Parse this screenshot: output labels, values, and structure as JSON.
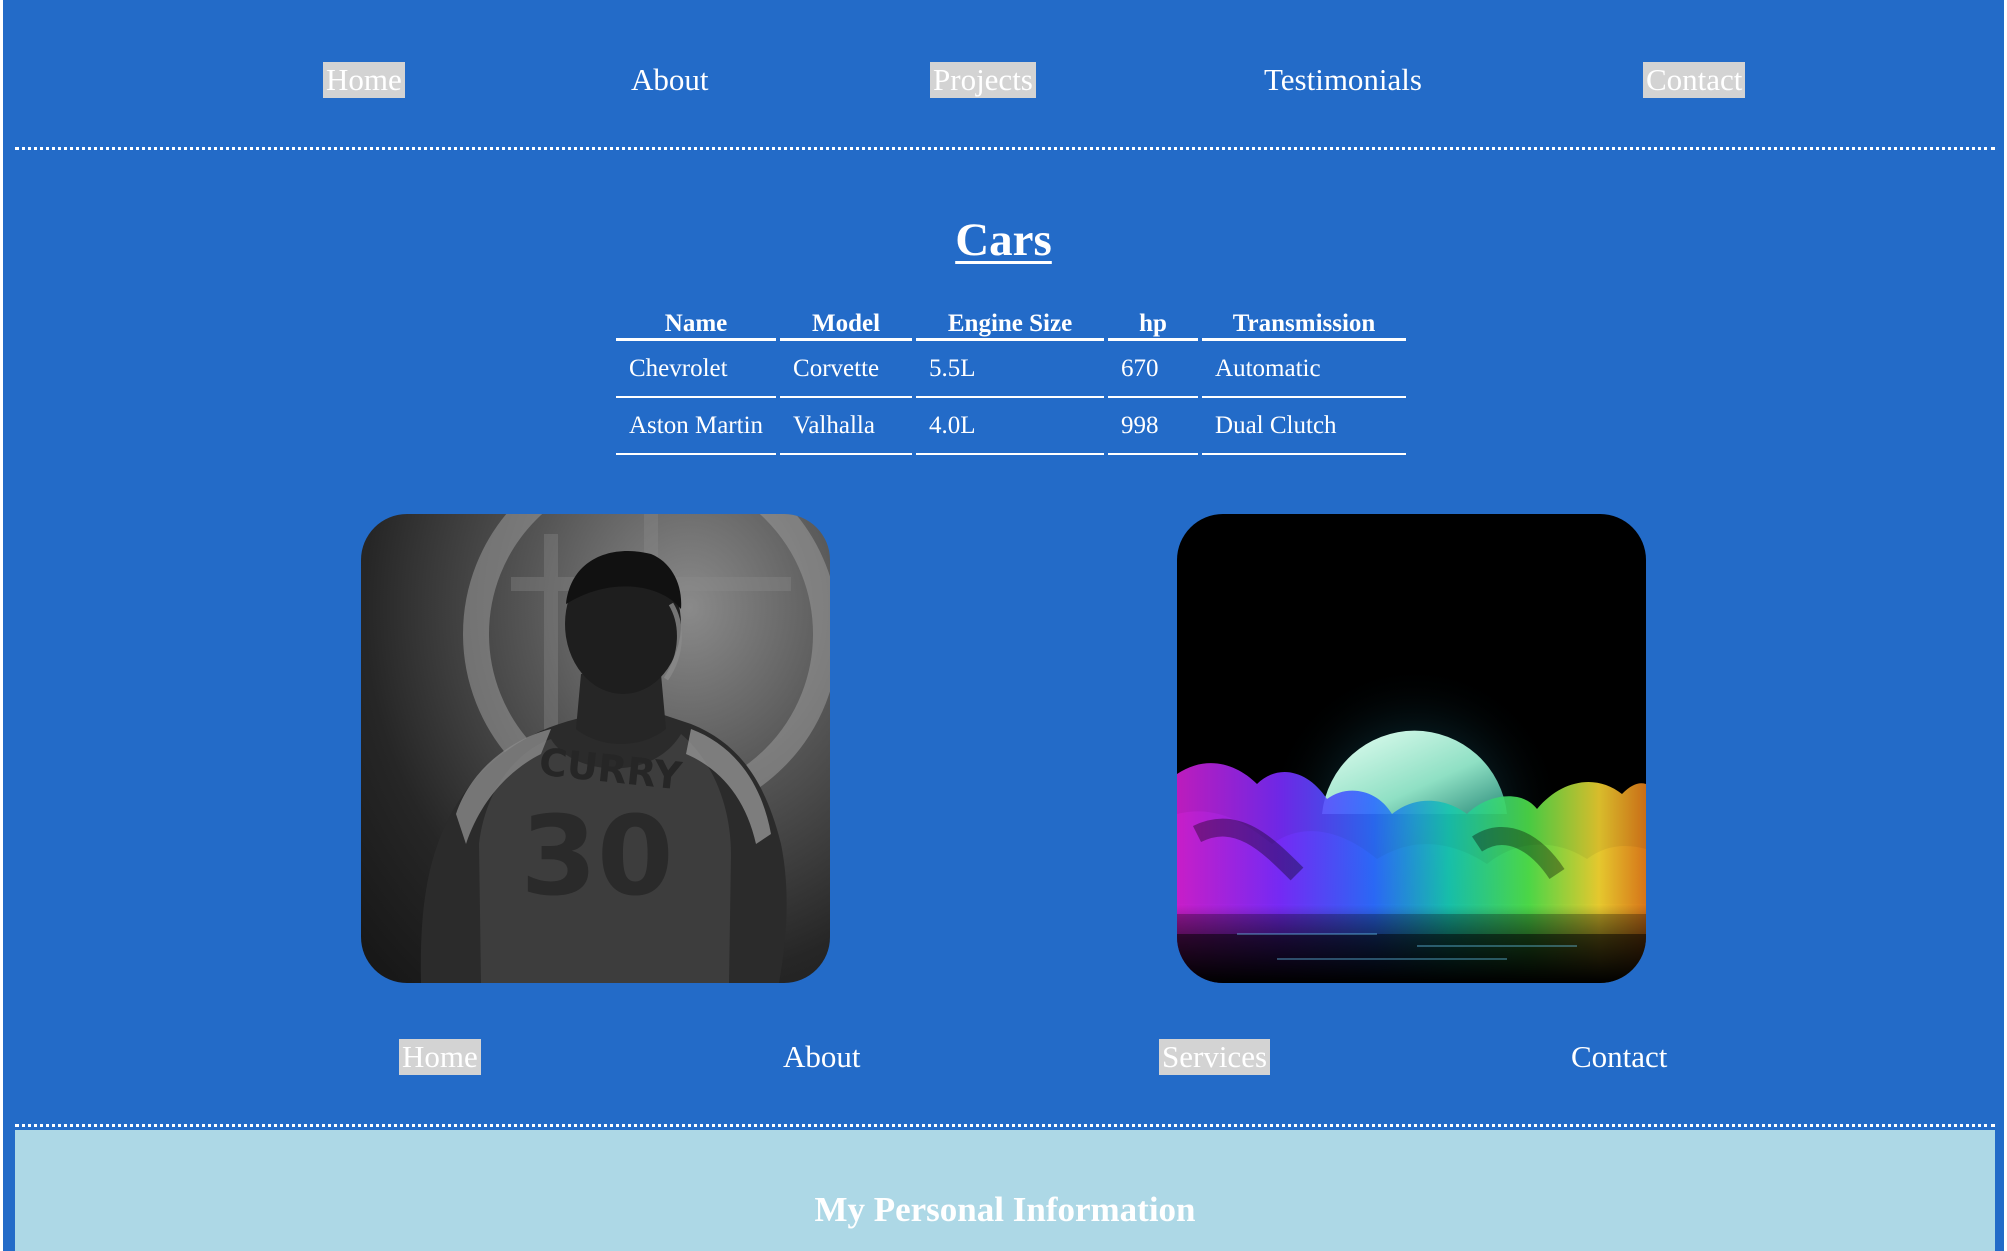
{
  "top_nav": {
    "items": [
      {
        "label": "Home",
        "highlighted": true
      },
      {
        "label": "About",
        "highlighted": false
      },
      {
        "label": "Projects",
        "highlighted": true
      },
      {
        "label": "Testimonials",
        "highlighted": false
      },
      {
        "label": "Contact",
        "highlighted": true
      }
    ]
  },
  "cars": {
    "title": "Cars",
    "columns": [
      "Name",
      "Model",
      "Engine Size",
      "hp",
      "Transmission"
    ],
    "rows": [
      [
        "Chevrolet",
        "Corvette",
        "5.5L",
        "670",
        "Automatic"
      ],
      [
        "Aston Martin",
        "Valhalla",
        "4.0L",
        "998",
        "Dual Clutch"
      ]
    ]
  },
  "images": [
    {
      "subject": "basketball-player-photo",
      "jersey_text": "CURRY",
      "jersey_number": "30"
    },
    {
      "subject": "neon-moon-clouds-photo"
    }
  ],
  "bottom_nav": {
    "items": [
      {
        "label": "Home",
        "highlighted": true
      },
      {
        "label": "About",
        "highlighted": false
      },
      {
        "label": "Services",
        "highlighted": true
      },
      {
        "label": "Contact",
        "highlighted": false
      }
    ]
  },
  "personal_info": {
    "title": "My Personal Information"
  },
  "colors": {
    "page_background": "#236bc8",
    "nav_highlight": "#d3d3d3",
    "info_background": "#add8e6",
    "text": "#ffffff"
  }
}
